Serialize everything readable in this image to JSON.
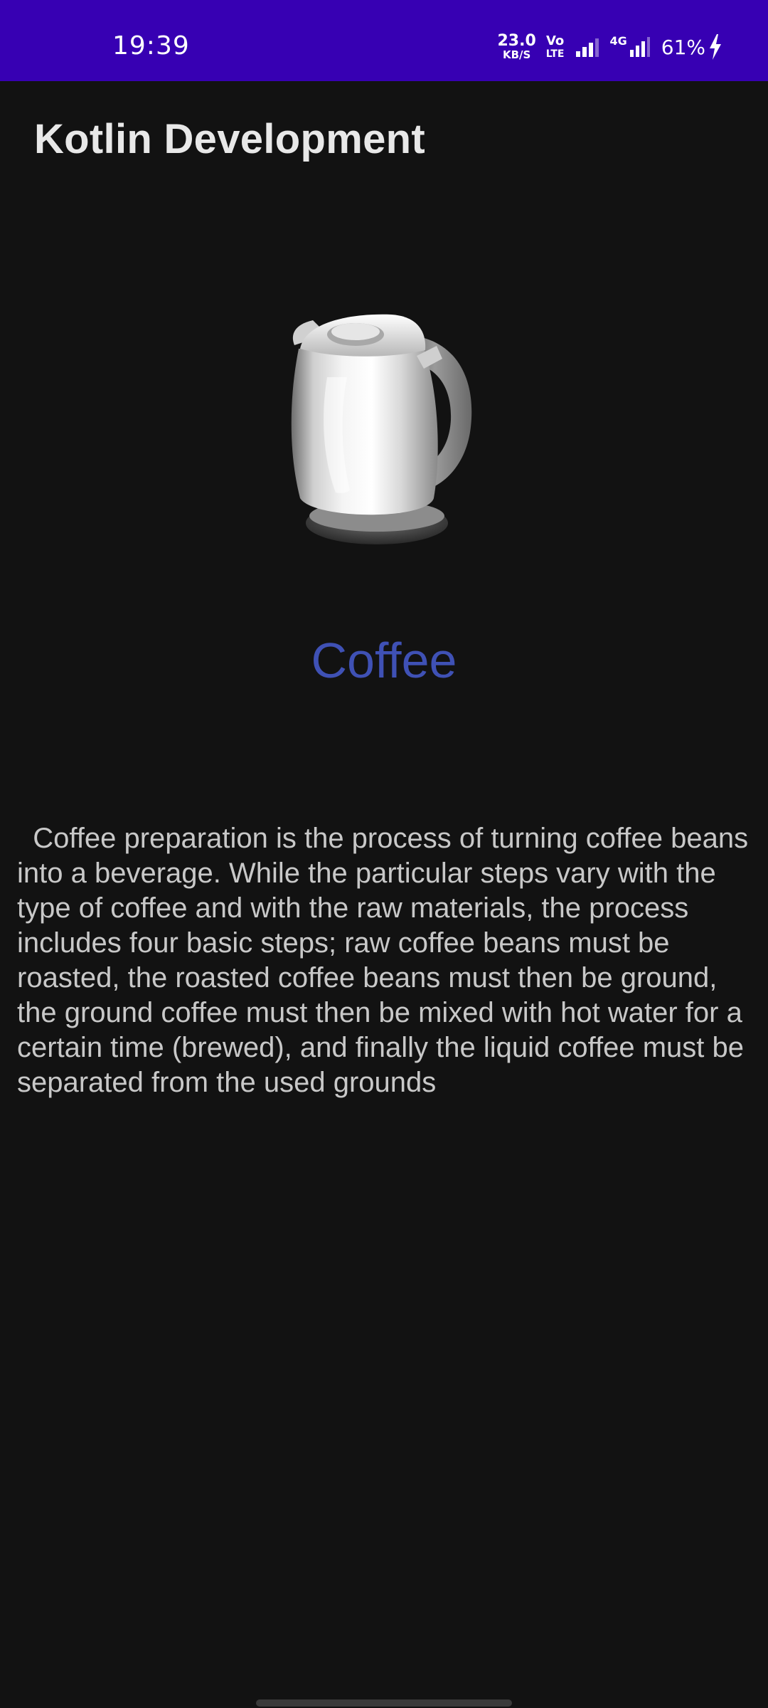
{
  "status_bar": {
    "time": "19:39",
    "speed_value": "23.0",
    "speed_unit": "KB/S",
    "volte_top": "Vo",
    "volte_bottom": "LTE",
    "network_type": "4G",
    "battery": "61%"
  },
  "app_bar": {
    "title": "Kotlin Development"
  },
  "content": {
    "image_icon": "kettle-icon",
    "title": "Coffee",
    "description": "  Coffee preparation is the process of turning coffee beans into a beverage. While the particular steps vary with the type of coffee and with the raw materials, the process includes four basic steps; raw coffee beans must be roasted, the roasted coffee beans must then be ground, the ground coffee must then be mixed with hot water for a certain time (brewed), and finally the liquid coffee must be separated from the used grounds"
  },
  "colors": {
    "status_bar": "#3700b3",
    "background": "#121212",
    "accent_title": "#3f51b5",
    "app_title": "#e8e8e8",
    "body_text": "#c8c8c8"
  }
}
